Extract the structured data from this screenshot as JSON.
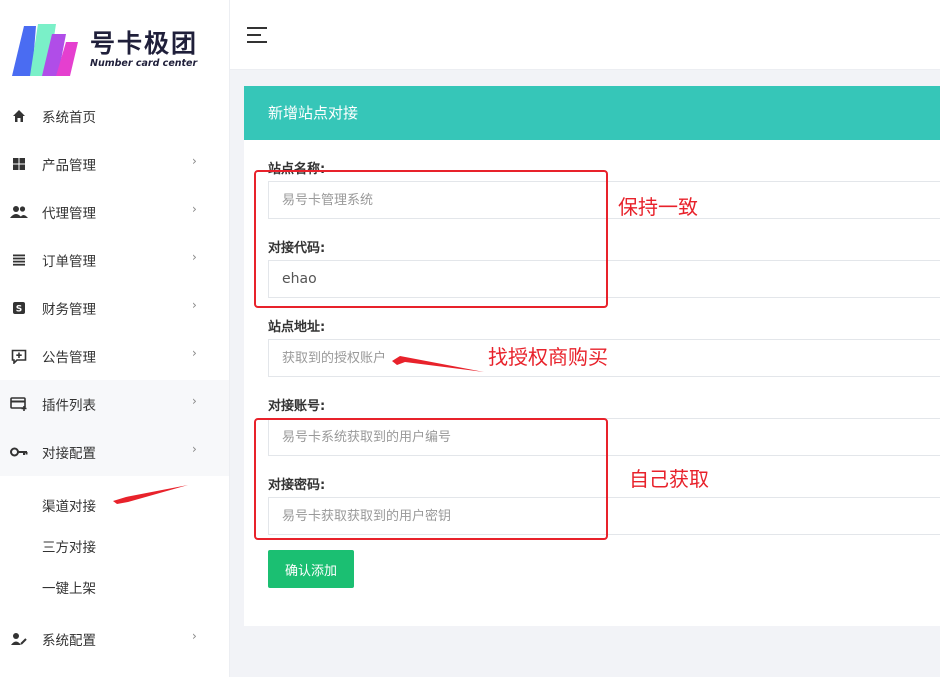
{
  "brand": {
    "title": "号卡极团",
    "subtitle": "Number card center",
    "colors": [
      "#3d6cf0",
      "#8a4df0",
      "#e13fd0",
      "#7af0c8"
    ]
  },
  "sidebar": {
    "items": [
      {
        "label": "系统首页",
        "icon": "home-icon",
        "has_arrow": false
      },
      {
        "label": "产品管理",
        "icon": "grid-icon",
        "has_arrow": true
      },
      {
        "label": "代理管理",
        "icon": "users-icon",
        "has_arrow": true
      },
      {
        "label": "订单管理",
        "icon": "list-icon",
        "has_arrow": true
      },
      {
        "label": "财务管理",
        "icon": "dollar-icon",
        "has_arrow": true
      },
      {
        "label": "公告管理",
        "icon": "announcement-icon",
        "has_arrow": true
      },
      {
        "label": "插件列表",
        "icon": "card-plus-icon",
        "has_arrow": true
      },
      {
        "label": "对接配置",
        "icon": "key-icon",
        "has_arrow": true
      },
      {
        "label": "系统配置",
        "icon": "user-edit-icon",
        "has_arrow": true
      }
    ],
    "sub_items": [
      "渠道对接",
      "三方对接",
      "一键上架"
    ],
    "arrow_glyph": "›"
  },
  "card": {
    "title": "新增站点对接",
    "fields": [
      {
        "label": "站点名称:",
        "value": "",
        "placeholder": "易号卡管理系统"
      },
      {
        "label": "对接代码:",
        "value": "ehao",
        "placeholder": ""
      },
      {
        "label": "站点地址:",
        "value": "",
        "placeholder": "获取到的授权账户"
      },
      {
        "label": "对接账号:",
        "value": "",
        "placeholder": "易号卡系统获取到的用户编号"
      },
      {
        "label": "对接密码:",
        "value": "",
        "placeholder": "易号卡获取获取到的用户密钥"
      }
    ],
    "submit_label": "确认添加",
    "header_color": "#36c6b8",
    "button_color": "#1bbf72"
  },
  "annotations": {
    "keep_consistent": "保持一致",
    "buy_from_agent": "找授权商购买",
    "get_yourself": "自己获取",
    "color": "#e8222b"
  }
}
